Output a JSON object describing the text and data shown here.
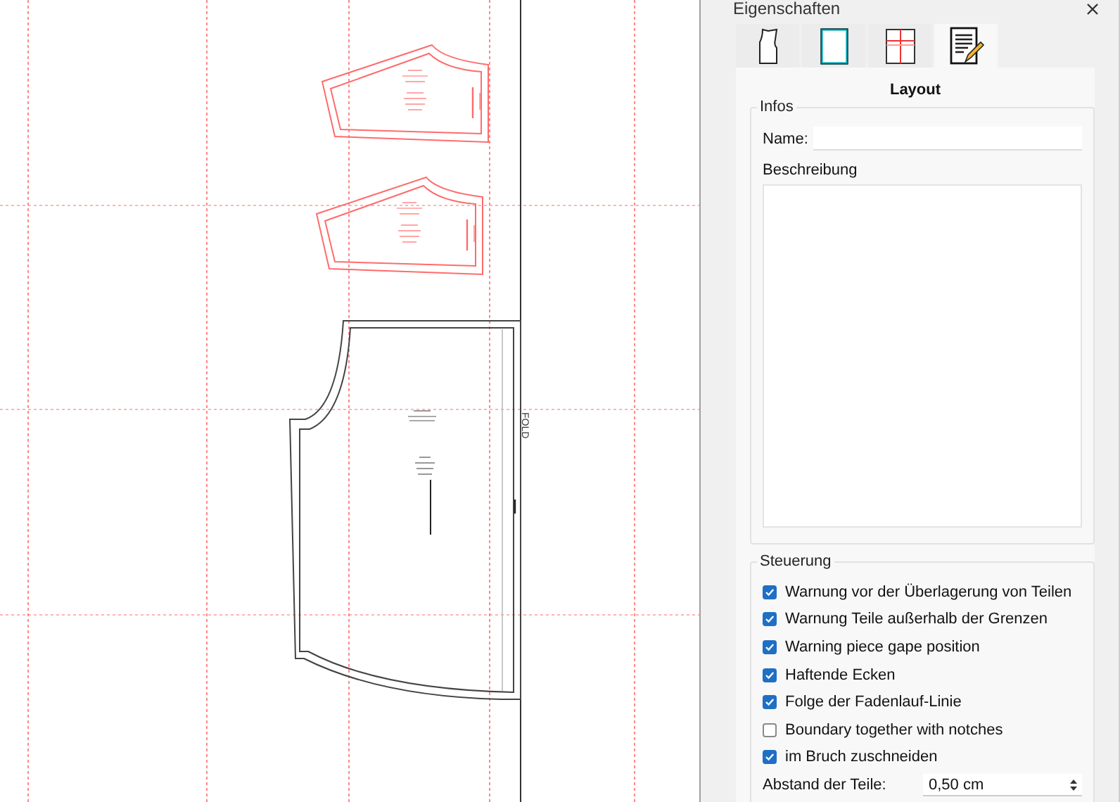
{
  "canvas": {
    "fold_label": "FOLD"
  },
  "panel": {
    "title": "Eigenschaften",
    "tabs": [
      {
        "kind": "piece",
        "selected": false
      },
      {
        "kind": "page",
        "selected": false
      },
      {
        "kind": "tiles",
        "selected": false
      },
      {
        "kind": "layout",
        "selected": true
      }
    ],
    "heading": "Layout",
    "infos": {
      "title": "Infos",
      "name_label": "Name:",
      "description_label": "Beschreibung"
    },
    "controls": {
      "title": "Steuerung",
      "options": [
        {
          "label": "Warnung vor der Überlagerung von Teilen",
          "checked": true
        },
        {
          "label": "Warnung Teile außerhalb der Grenzen",
          "checked": true
        },
        {
          "label": "Warning piece gape position",
          "checked": true
        },
        {
          "label": "Haftende Ecken",
          "checked": true
        },
        {
          "label": "Folge der Fadenlauf-Linie",
          "checked": true
        },
        {
          "label": "Boundary together with notches",
          "checked": false
        },
        {
          "label": "im Bruch zuschneiden",
          "checked": true
        }
      ],
      "spacing_label": "Abstand der Teile:",
      "spacing_value": "0,50 cm"
    }
  }
}
